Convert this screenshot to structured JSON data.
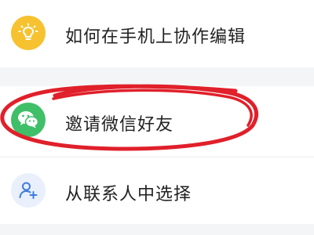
{
  "colors": {
    "background": "#ffffff",
    "separator_band": "#f4f5f7",
    "text": "#222222",
    "help_icon_bg": "#f6c22f",
    "wechat_icon_bg": "#3fbf68",
    "contacts_icon_bg": "#e9f0fb",
    "contacts_icon_fg": "#3d7be0",
    "annotation_circle": "#e0202a"
  },
  "menu": {
    "items": [
      {
        "label": "如何在手机上协作编辑",
        "icon": "lightbulb-icon"
      },
      {
        "label": "邀请微信好友",
        "icon": "wechat-icon"
      },
      {
        "label": "从联系人中选择",
        "icon": "add-contact-icon"
      }
    ]
  },
  "annotation": {
    "shape": "hand-drawn red circle",
    "target": "邀请微信好友"
  }
}
